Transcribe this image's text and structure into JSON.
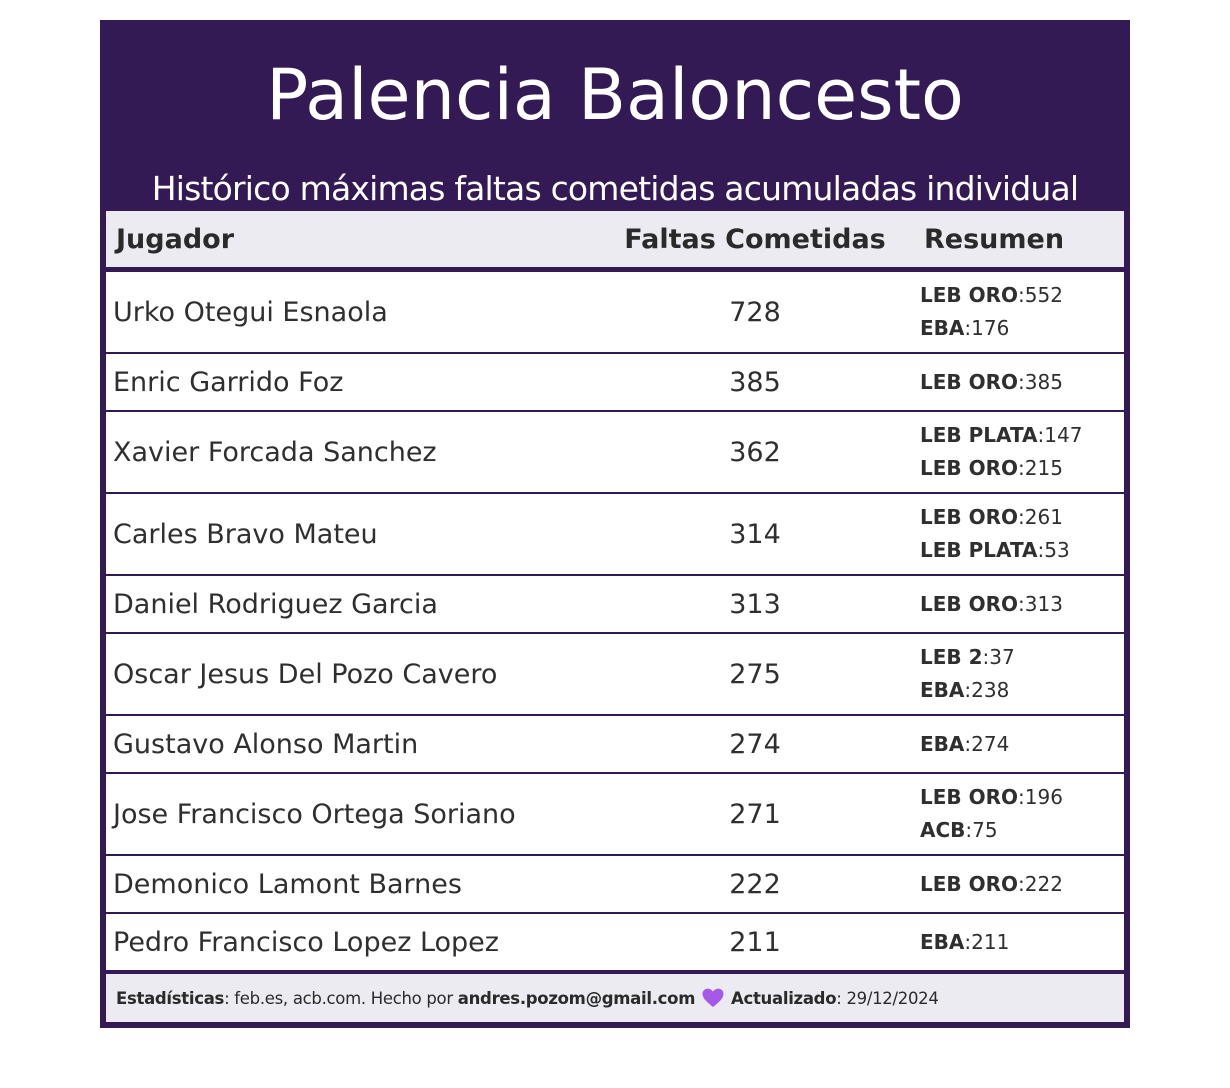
{
  "title": "Palencia Baloncesto",
  "subtitle": "Histórico máximas faltas cometidas acumuladas individual",
  "columns": {
    "player": "Jugador",
    "fouls": "Faltas Cometidas",
    "summary": "Resumen"
  },
  "rows": [
    {
      "name": "Urko Otegui Esnaola",
      "fouls": "728",
      "summary": [
        {
          "league": "LEB ORO",
          "value": "552"
        },
        {
          "league": "EBA",
          "value": "176"
        }
      ]
    },
    {
      "name": "Enric Garrido Foz",
      "fouls": "385",
      "summary": [
        {
          "league": "LEB ORO",
          "value": "385"
        }
      ]
    },
    {
      "name": "Xavier Forcada Sanchez",
      "fouls": "362",
      "summary": [
        {
          "league": "LEB PLATA",
          "value": "147"
        },
        {
          "league": "LEB ORO",
          "value": "215"
        }
      ]
    },
    {
      "name": "Carles Bravo Mateu",
      "fouls": "314",
      "summary": [
        {
          "league": "LEB ORO",
          "value": "261"
        },
        {
          "league": "LEB PLATA",
          "value": "53"
        }
      ]
    },
    {
      "name": "Daniel Rodriguez Garcia",
      "fouls": "313",
      "summary": [
        {
          "league": "LEB ORO",
          "value": "313"
        }
      ]
    },
    {
      "name": "Oscar Jesus Del Pozo Cavero",
      "fouls": "275",
      "summary": [
        {
          "league": "LEB 2",
          "value": "37"
        },
        {
          "league": "EBA",
          "value": "238"
        }
      ]
    },
    {
      "name": "Gustavo Alonso Martin",
      "fouls": "274",
      "summary": [
        {
          "league": "EBA",
          "value": "274"
        }
      ]
    },
    {
      "name": "Jose Francisco Ortega Soriano",
      "fouls": "271",
      "summary": [
        {
          "league": "LEB ORO",
          "value": "196"
        },
        {
          "league": "ACB",
          "value": "75"
        }
      ]
    },
    {
      "name": "Demonico Lamont Barnes",
      "fouls": "222",
      "summary": [
        {
          "league": "LEB ORO",
          "value": "222"
        }
      ]
    },
    {
      "name": "Pedro Francisco Lopez Lopez",
      "fouls": "211",
      "summary": [
        {
          "league": "EBA",
          "value": "211"
        }
      ]
    }
  ],
  "footer": {
    "stats_label": "Estadísticas",
    "stats_text": ": feb.es, acb.com. Hecho por ",
    "author": "andres.pozom@gmail.com",
    "updated_label": "Actualizado",
    "updated_text": ": 29/12/2024"
  },
  "colors": {
    "brand_purple": "#341a55",
    "header_bg": "#ecebf1",
    "heart": "#a659e8"
  }
}
